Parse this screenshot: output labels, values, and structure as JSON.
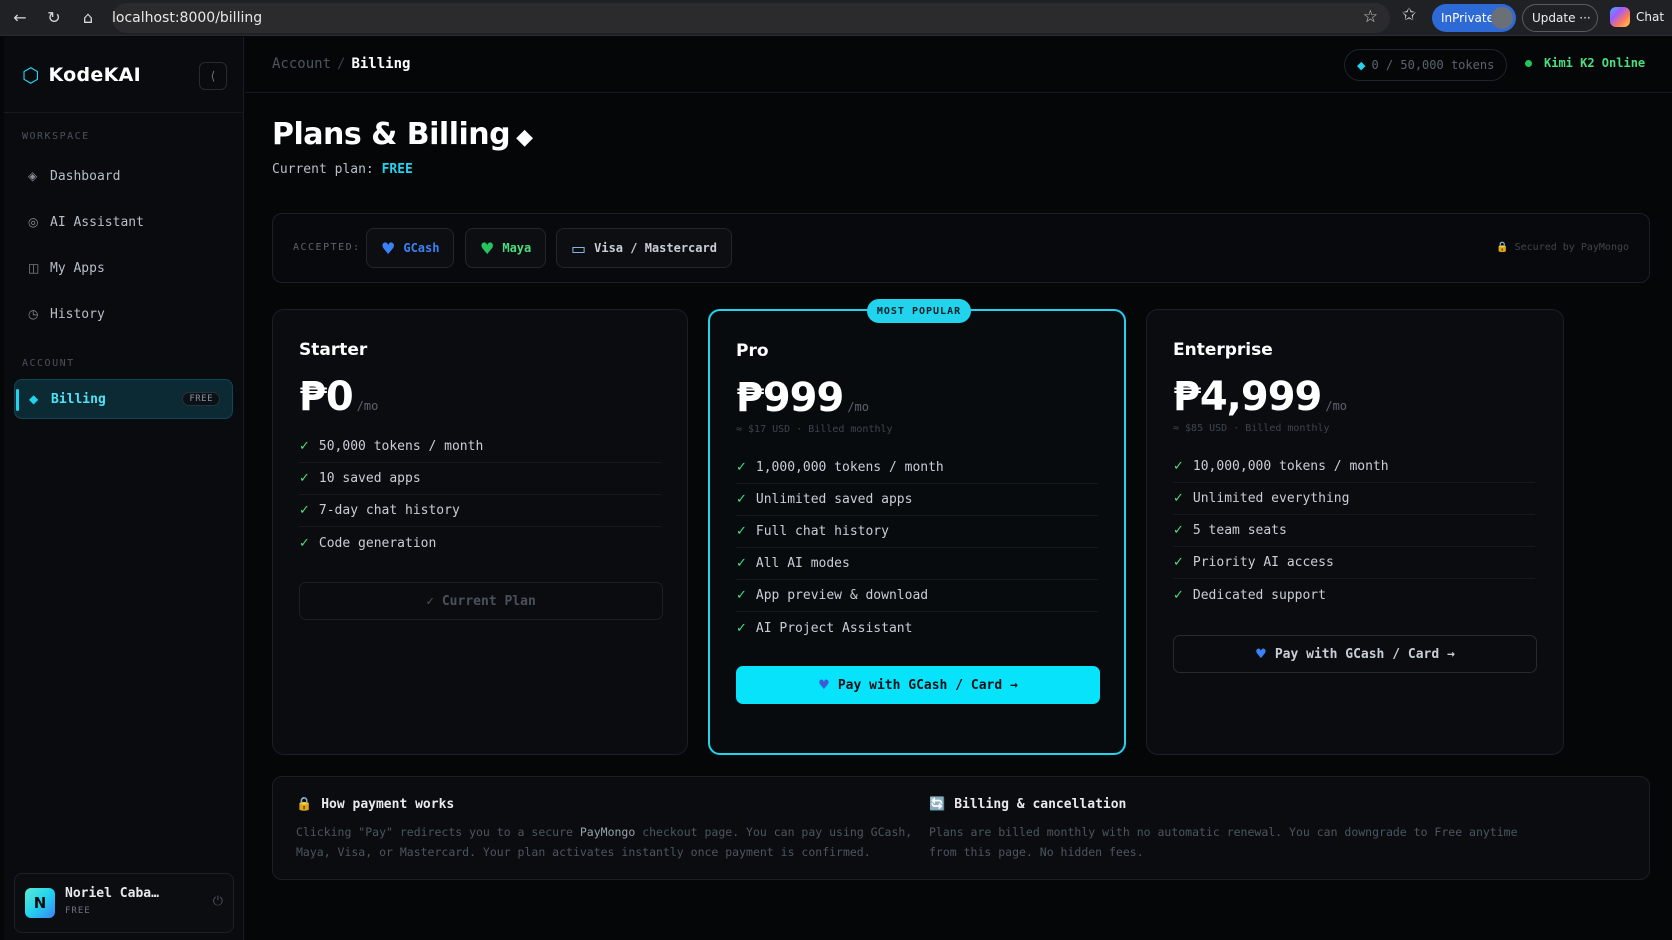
{
  "browser": {
    "url": "localhost:8000/billing",
    "inprivate_label": "InPrivate",
    "update_label": "Update",
    "chat_label": "Chat"
  },
  "sidebar": {
    "brand": "KodeKAI",
    "workspace_label": "WORKSPACE",
    "account_label": "ACCOUNT",
    "items": [
      {
        "label": "Dashboard",
        "icon": "diamond-outline-icon"
      },
      {
        "label": "AI Assistant",
        "icon": "target-icon"
      },
      {
        "label": "My Apps",
        "icon": "columns-icon"
      },
      {
        "label": "History",
        "icon": "clock-icon"
      }
    ],
    "billing": {
      "label": "Billing",
      "badge": "FREE",
      "icon": "diamond-icon"
    },
    "user": {
      "initial": "N",
      "name": "Noriel Caba…",
      "plan": "FREE"
    }
  },
  "topbar": {
    "breadcrumb_parent": "Account",
    "breadcrumb_sep": "/",
    "breadcrumb_current": "Billing",
    "tokens": "0 / 50,000 tokens",
    "status": "Kimi K2 Online"
  },
  "page": {
    "title": "Plans & Billing",
    "title_glyph": "◆",
    "current_plan_label": "Current plan:",
    "current_plan_value": "FREE"
  },
  "accepted": {
    "label": "ACCEPTED:",
    "methods": [
      {
        "name": "GCash",
        "color": "#3b82f6"
      },
      {
        "name": "Maya",
        "color": "#4ade80"
      },
      {
        "name": "Visa / Mastercard",
        "color": "#c9ced6"
      }
    ],
    "secured": "Secured by PayMongo"
  },
  "plans": [
    {
      "name": "Starter",
      "price": "₱0",
      "per": "/mo",
      "sub": "",
      "features": [
        "50,000 tokens / month",
        "10 saved apps",
        "7-day chat history",
        "Code generation"
      ],
      "button": "✓ Current Plan"
    },
    {
      "name": "Pro",
      "badge": "MOST POPULAR",
      "price": "₱999",
      "per": "/mo",
      "sub": "≈ $17 USD · Billed monthly",
      "features": [
        "1,000,000 tokens / month",
        "Unlimited saved apps",
        "Full chat history",
        "All AI modes",
        "App preview & download",
        "AI Project Assistant"
      ],
      "button": "Pay with GCash / Card →"
    },
    {
      "name": "Enterprise",
      "price": "₱4,999",
      "per": "/mo",
      "sub": "≈ $85 USD · Billed monthly",
      "features": [
        "10,000,000 tokens / month",
        "Unlimited everything",
        "5 team seats",
        "Priority AI access",
        "Dedicated support"
      ],
      "button": "Pay with GCash / Card →"
    }
  ],
  "info": {
    "how": {
      "title": "How payment works",
      "body_1": "Clicking \"Pay\" redirects you to a secure ",
      "body_strong": "PayMongo",
      "body_2": " checkout page. You can pay using GCash, Maya, Visa, or Mastercard. Your plan activates instantly once payment is confirmed."
    },
    "billing": {
      "title": "Billing & cancellation",
      "body": "Plans are billed monthly with no automatic renewal. You can downgrade to Free anytime from this page. No hidden fees."
    }
  }
}
